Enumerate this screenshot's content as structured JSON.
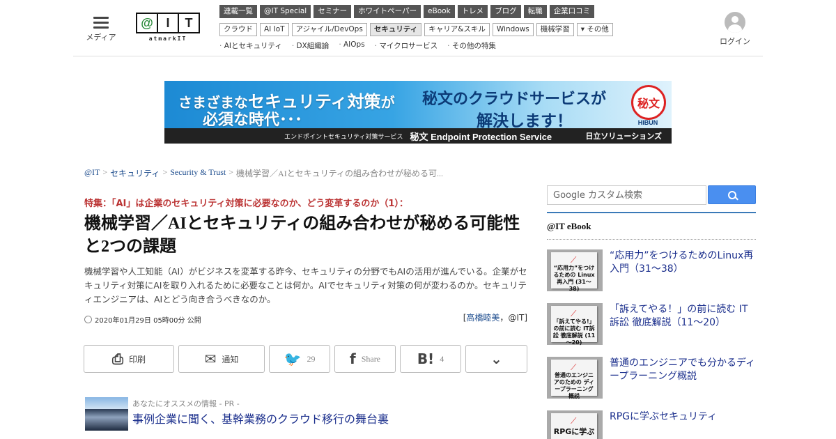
{
  "header": {
    "menu_label": "メディア",
    "logo_cells": [
      "@",
      "I",
      "T"
    ],
    "logo_sub": "atmarkIT",
    "login_label": "ログイン",
    "nav_dark": [
      "連載一覧",
      "@IT Special",
      "セミナー",
      "ホワイトペーパー",
      "eBook",
      "トレメ",
      "ブログ",
      "転職",
      "企業口コミ"
    ],
    "nav_light": [
      "クラウド",
      "AI IoT",
      "アジャイル/DevOps",
      "セキュリティ",
      "キャリア&スキル",
      "Windows",
      "機械学習",
      "▾ その他"
    ],
    "nav_light_active": "セキュリティ",
    "topics": [
      "AIとセキュリティ",
      "DX組織論",
      "AIOps",
      "マイクロサービス",
      "その他の特集"
    ]
  },
  "banner": {
    "line1_pre": "さまざまな",
    "line1_big": "セキュリティ対策",
    "line1_post": "が",
    "line2": "必須な時代･･･",
    "right1": "秘文のクラウドサービスが",
    "right2": "解決します！",
    "seal_text": "秘文",
    "seal_sub": "HIBUN",
    "bar_small": "エンドポイントセキュリティ対策サービス",
    "bar_main": "秘文 Endpoint Protection Service",
    "bar_brand": "日立ソリューションズ"
  },
  "breadcrumb": {
    "items": [
      "@IT",
      "セキュリティ",
      "Security & Trust"
    ],
    "current": "機械学習／AIとセキュリティの組み合わせが秘める可...",
    "sep": ">"
  },
  "article": {
    "kicker": "特集：「AI」は企業のセキュリティ対策に必要なのか、どう変革するのか（1）：",
    "title": "機械学習／AIとセキュリティの組み合わせが秘める可能性と2つの課題",
    "lead": "機械学習や人工知能（AI）がビジネスを変革する昨今、セキュリティの分野でもAIの活用が進んでいる。企業がセキュリティ対策にAIを取り入れるために必要なことは何か。AIでセキュリティ対策の何が変わるのか。セキュリティエンジニアは、AIとどう向き合うべきなのか。",
    "date": "2020年01月29日 05時00分 公開",
    "author_open": "[",
    "author_name": "高橋睦美",
    "author_sep": "，",
    "author_org": "@IT",
    "author_close": "]"
  },
  "share": {
    "print": "印刷",
    "notify": "通知",
    "twitter_count": "29",
    "facebook": "Share",
    "hatena_count": "4"
  },
  "pr": {
    "label": "あなたにオススメの情報 - PR -",
    "link": "事例企業に聞く、基幹業務のクラウド移行の舞台裏"
  },
  "sidebar": {
    "search_placeholder": "Google カスタム検索",
    "ebook_heading": "@IT eBook",
    "books": [
      {
        "title": "“応用力”をつけるためのLinux再入門（31～38）",
        "cover": "“応用力”をつけるための Linux再入門 (31～38)"
      },
      {
        "title": "「訴えてやる！」の前に読む IT訴訟 徹底解説（11～20）",
        "cover": "「訴えてやる!」の前に読む IT訴訟 徹底解説 (11～20)"
      },
      {
        "title": "普通のエンジニアでも分かるディープラーニング概説",
        "cover": "普通のエンジニアのための ディープラーニング 概説"
      },
      {
        "title": "RPGに学ぶセキュリティ",
        "cover": "RPGに学ぶ"
      }
    ]
  }
}
